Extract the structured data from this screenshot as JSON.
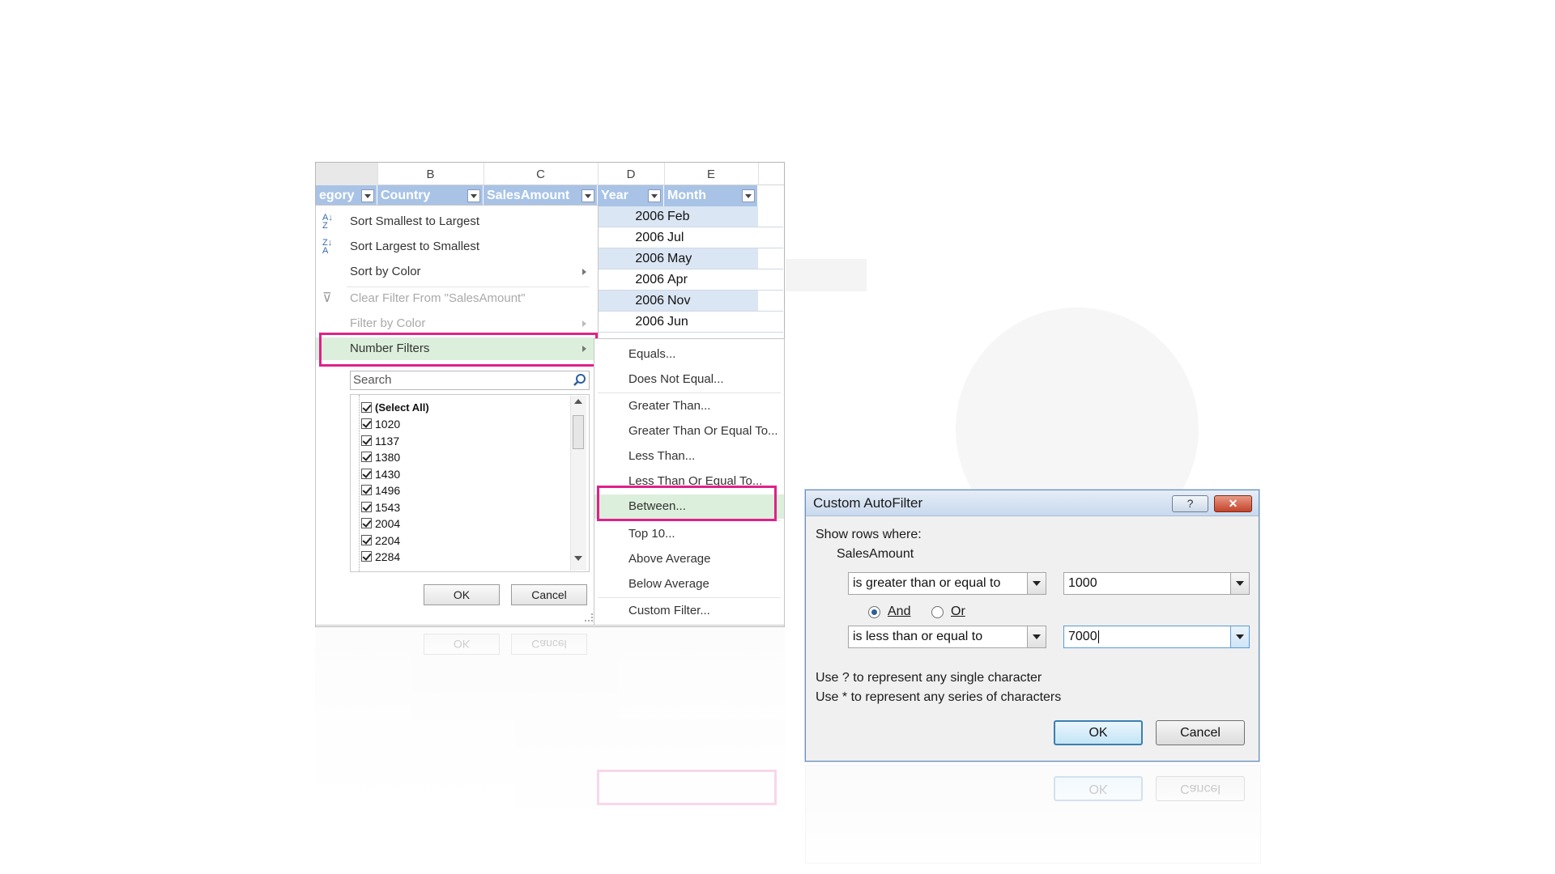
{
  "sheet": {
    "columns": [
      "B",
      "C",
      "D",
      "E"
    ],
    "headers": {
      "category": "egory",
      "country": "Country",
      "sales_amount": "SalesAmount",
      "year": "Year",
      "month": "Month"
    },
    "rows": [
      {
        "year": "2006",
        "month": "Feb"
      },
      {
        "year": "2006",
        "month": "Jul"
      },
      {
        "year": "2006",
        "month": "May"
      },
      {
        "year": "2006",
        "month": "Apr"
      },
      {
        "year": "2006",
        "month": "Nov"
      },
      {
        "year": "2006",
        "month": "Jun"
      }
    ]
  },
  "filter_menu": {
    "sort_asc": "Sort Smallest to Largest",
    "sort_desc": "Sort Largest to Smallest",
    "sort_color": "Sort by Color",
    "clear_filter": "Clear Filter From \"SalesAmount\"",
    "filter_color": "Filter by Color",
    "number_filters": "Number Filters",
    "search_placeholder": "Search",
    "values": [
      "(Select All)",
      "1020",
      "1137",
      "1380",
      "1430",
      "1496",
      "1543",
      "2004",
      "2204",
      "2284"
    ],
    "ok": "OK",
    "cancel": "Cancel"
  },
  "number_filters_submenu": [
    "Equals...",
    "Does Not Equal...",
    "Greater Than...",
    "Greater Than Or Equal To...",
    "Less Than...",
    "Less Than Or Equal To...",
    "Between...",
    "Top 10...",
    "Above Average",
    "Below Average",
    "Custom Filter..."
  ],
  "dialog": {
    "title": "Custom AutoFilter",
    "help": "?",
    "close": "✕",
    "show_rows": "Show rows where:",
    "field": "SalesAmount",
    "op1": "is greater than or equal to",
    "val1": "1000",
    "and_label": "And",
    "or_label": "Or",
    "logic_selected": "And",
    "op2": "is less than or equal to",
    "val2": "7000",
    "hint1": "Use ? to represent any single character",
    "hint2": "Use * to represent any series of characters",
    "ok": "OK",
    "cancel": "Cancel"
  },
  "colors": {
    "highlight": "#e0218a",
    "header_fill": "#a8c3e6",
    "selected_item": "#dcefdc"
  }
}
